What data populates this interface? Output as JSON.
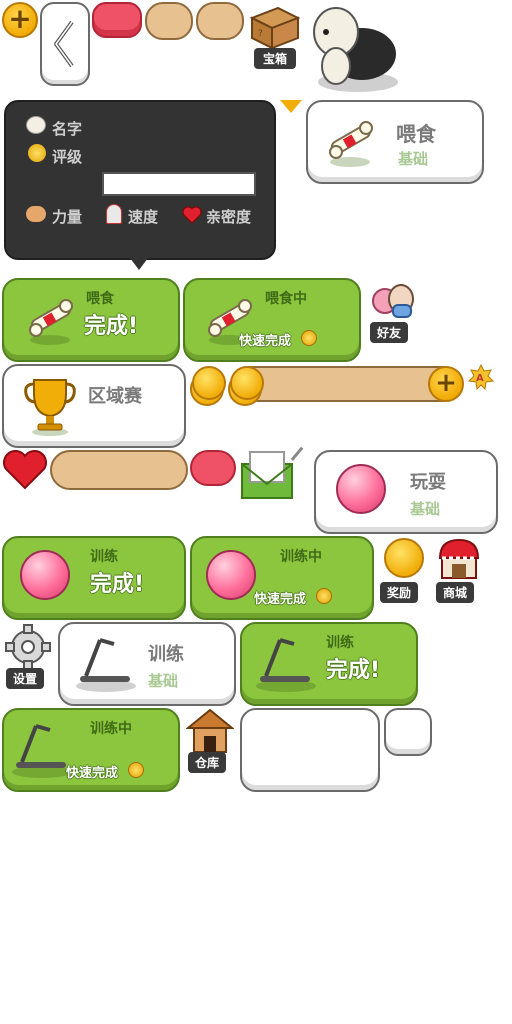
{
  "top_bar": {
    "treasure_label": "宝箱"
  },
  "profile_panel": {
    "name_label": "名字",
    "rating_label": "评级",
    "strength_label": "力量",
    "speed_label": "速度",
    "affinity_label": "亲密度"
  },
  "feed_basic": {
    "title": "喂食",
    "subtitle": "基础"
  },
  "feed_done": {
    "title": "喂食",
    "status": "完成!"
  },
  "feed_progress": {
    "title": "喂食中",
    "quick": "快速完成"
  },
  "friends": {
    "label": "好友"
  },
  "tournament": {
    "title": "区域赛"
  },
  "play_basic": {
    "title": "玩耍",
    "subtitle": "基础"
  },
  "train_done_ball": {
    "title": "训练",
    "status": "完成!"
  },
  "train_progress_ball": {
    "title": "训练中",
    "quick": "快速完成"
  },
  "rewards": {
    "label": "奖励"
  },
  "shop": {
    "label": "商城"
  },
  "settings": {
    "label": "设置"
  },
  "train_basic": {
    "title": "训练",
    "subtitle": "基础"
  },
  "train_done_tm": {
    "title": "训练",
    "status": "完成!"
  },
  "train_progress_tm": {
    "title": "训练中",
    "quick": "快速完成"
  },
  "warehouse": {
    "label": "仓库"
  },
  "colors": {
    "green": "#8cc63f",
    "dark_panel": "#333333",
    "gold": "#f1ad08",
    "pink": "#ff6f9b",
    "tan": "#e7c18f",
    "red": "#ef5266"
  }
}
